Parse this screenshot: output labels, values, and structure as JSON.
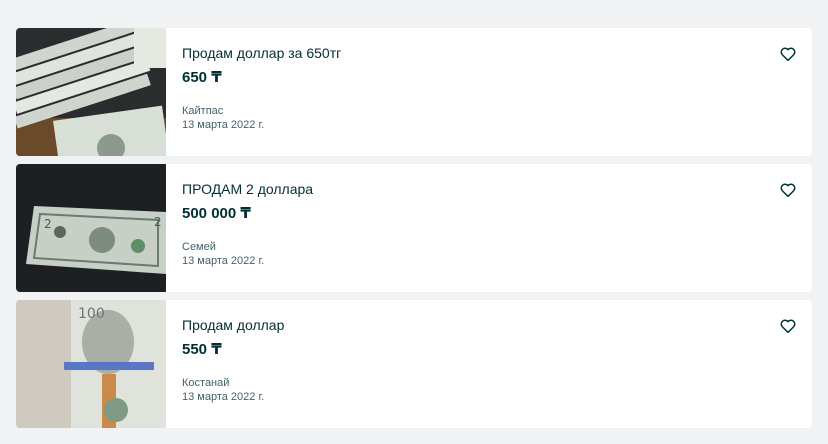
{
  "listings": [
    {
      "title": "Продам доллар за 650тг",
      "price": "650 ₸",
      "location": "Кайтпас",
      "date": "13 марта 2022 г.",
      "favorite_icon": "heart-outline-icon"
    },
    {
      "title": "ПРОДАМ 2 доллара",
      "price": "500 000 ₸",
      "location": "Семей",
      "date": "13 марта 2022 г.",
      "favorite_icon": "heart-outline-icon"
    },
    {
      "title": "Продам доллар",
      "price": "550 ₸",
      "location": "Костанай",
      "date": "13 марта 2022 г.",
      "favorite_icon": "heart-outline-icon"
    }
  ],
  "colors": {
    "background": "#f1f2f4",
    "card": "#ffffff",
    "text": "#002f34",
    "secondary_text": "#406367"
  }
}
